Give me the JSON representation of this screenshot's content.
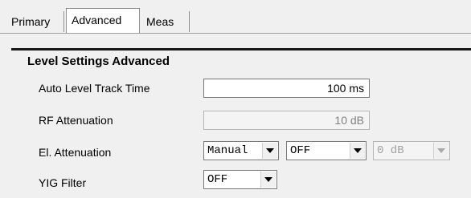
{
  "tabs": {
    "primary": "Primary",
    "advanced": "Advanced",
    "meas": "Meas"
  },
  "section": {
    "title": "Level Settings Advanced"
  },
  "rows": {
    "auto_level_track_time": {
      "label": "Auto Level Track Time",
      "value": "100 ms"
    },
    "rf_attenuation": {
      "label": "RF Attenuation",
      "value": "10 dB"
    },
    "el_attenuation": {
      "label": "El. Attenuation",
      "mode": "Manual",
      "state": "OFF",
      "value": "0 dB"
    },
    "yig_filter": {
      "label": "YIG Filter",
      "value": "OFF"
    }
  }
}
